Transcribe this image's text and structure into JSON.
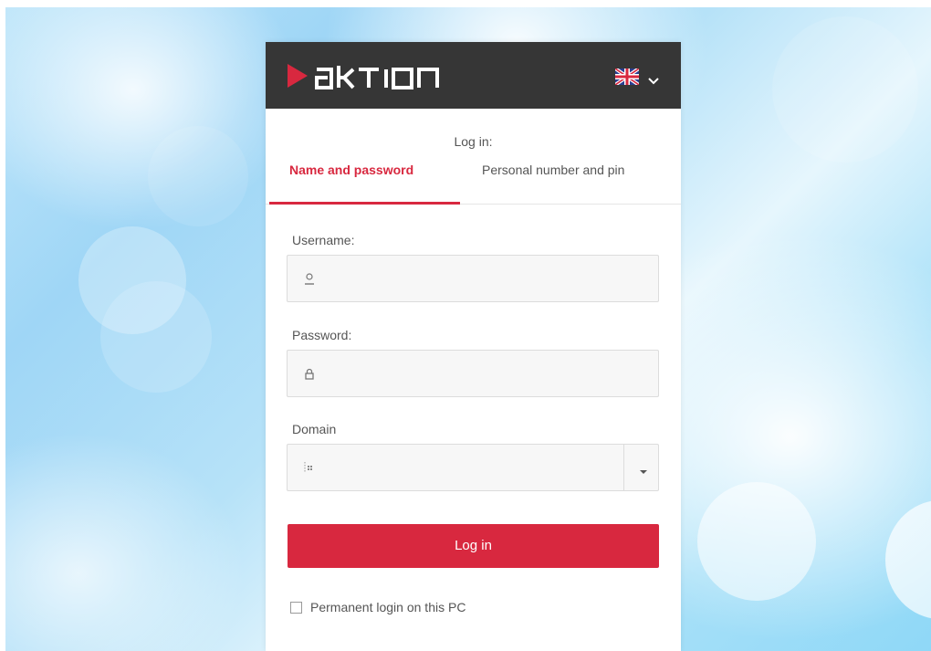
{
  "brand": {
    "logo_text": "aKTION",
    "accent_color": "#d8283f",
    "header_color": "#363636"
  },
  "language": {
    "flag_icon": "uk-flag-icon",
    "dropdown_icon": "chevron-down-icon"
  },
  "login": {
    "heading": "Log in:",
    "tabs": [
      {
        "label": "Name and password",
        "active": true
      },
      {
        "label": "Personal number and pin",
        "active": false
      }
    ],
    "username_label": "Username:",
    "username_value": "",
    "username_icon": "user-icon",
    "password_label": "Password:",
    "password_value": "",
    "password_icon": "lock-icon",
    "domain_label": "Domain",
    "domain_value": "",
    "domain_icon": "domain-icon",
    "submit_label": "Log in",
    "remember_label": "Permanent login on this PC",
    "remember_checked": false
  }
}
